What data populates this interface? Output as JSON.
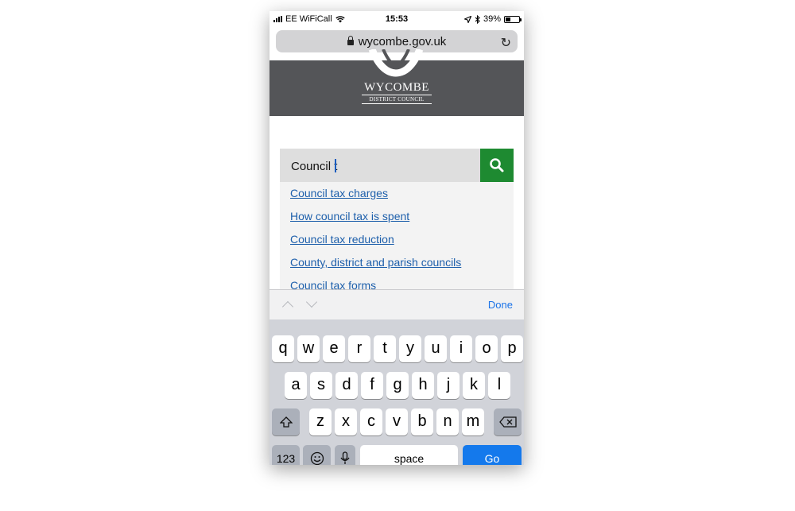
{
  "status_bar": {
    "carrier": "EE WiFiCall",
    "time": "15:53",
    "battery_text": "39%",
    "battery_level": 0.39
  },
  "browser": {
    "url": "wycombe.gov.uk"
  },
  "header": {
    "logo_title": "WYCOMBE",
    "logo_subtitle": "DISTRICT COUNCIL"
  },
  "search": {
    "value": "Council t",
    "button_icon": "search-icon",
    "button_color": "#1e8a31"
  },
  "suggestions": [
    "Council tax charges",
    "How council tax is spent",
    "Council tax reduction",
    "County, district and parish councils",
    "Council tax forms"
  ],
  "accessory": {
    "done_label": "Done"
  },
  "keyboard": {
    "row1": [
      "q",
      "w",
      "e",
      "r",
      "t",
      "y",
      "u",
      "i",
      "o",
      "p"
    ],
    "row2": [
      "a",
      "s",
      "d",
      "f",
      "g",
      "h",
      "j",
      "k",
      "l"
    ],
    "row3": [
      "z",
      "x",
      "c",
      "v",
      "b",
      "n",
      "m"
    ],
    "numbers_label": "123",
    "space_label": "space",
    "go_label": "Go",
    "go_color": "#1479ec"
  }
}
